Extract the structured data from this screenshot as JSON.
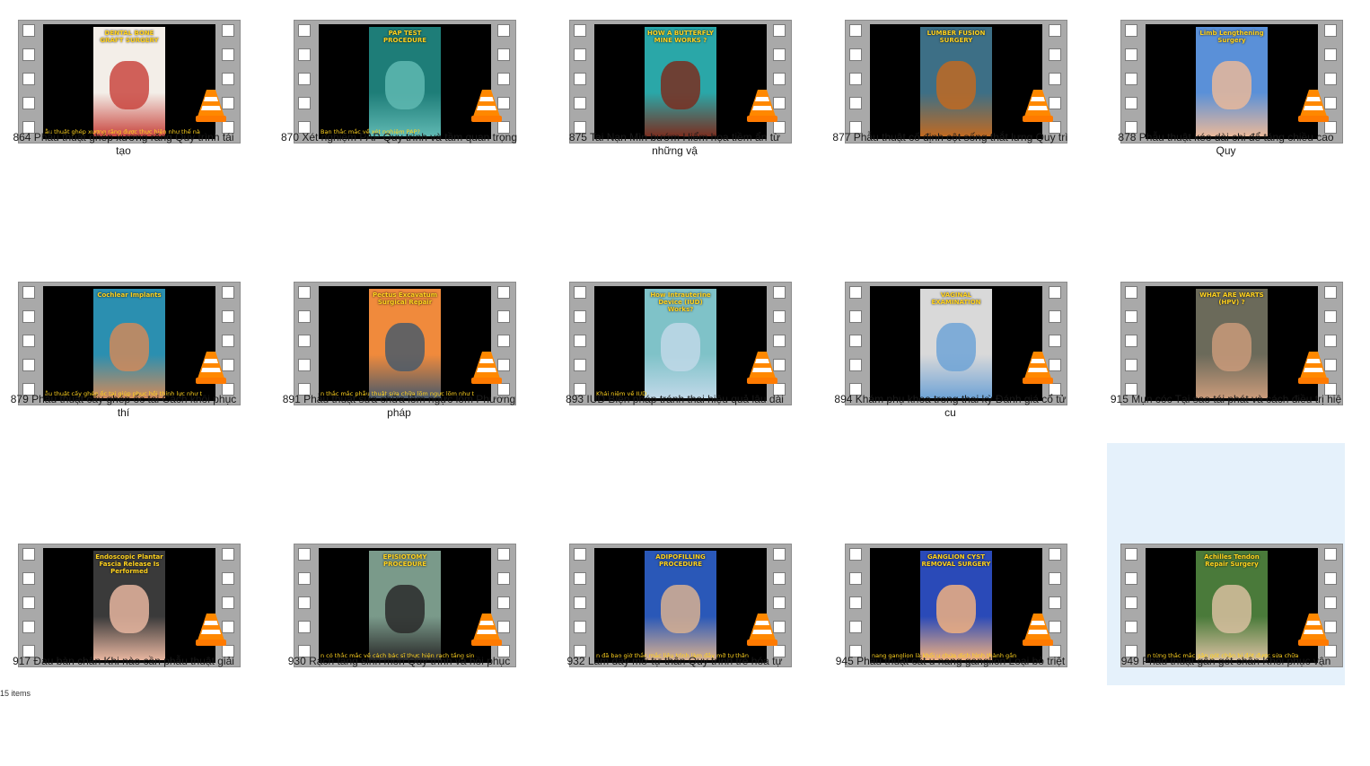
{
  "items": [
    {
      "label": "864 Phẫu thuật ghép xương răng Quy trình tái tạo",
      "poster_title": "DENTAL BONE GRAFT SURGERY",
      "subtitle": "ẫu thuật ghép xương răng được thực hiện như thế nà",
      "bg": "#f3eee8",
      "accent": "#c9463f"
    },
    {
      "label": "870 Xét nghiệm PAP Quy trình và tầm quan trọng",
      "poster_title": "PAP TEST PROCEDURE",
      "subtitle": "Bạn thắc mắc về xét nghiệm PAP?",
      "bg": "#1e7d78",
      "accent": "#5fb8b2"
    },
    {
      "label": "875 Tai Nạn Mìn bướm Hiểm họa tiềm ẩn từ những vậ",
      "poster_title": "HOW A BUTTERFLY MINE WORKS ?",
      "subtitle": "",
      "bg": "#2aa7a8",
      "accent": "#7a2e20"
    },
    {
      "label": "877 Phẫu thuật cố định cột sống thắt lưng Quy trì",
      "poster_title": "LUMBER FUSION SURGERY",
      "subtitle": "",
      "bg": "#3d6f86",
      "accent": "#c06a22"
    },
    {
      "label": "878 Phẫu thuật kéo dài chi để tăng chiều cao Quy",
      "poster_title": "Limb Lengthening Surgery",
      "subtitle": "",
      "bg": "#5a90d8",
      "accent": "#e9b89a"
    },
    {
      "label": "879 Phẫu thuật cấy ghép ốc tai Cách khôi phục thí",
      "poster_title": "Cochlear Implants",
      "subtitle": "ẫu thuật cấy ghép ốc tai giúp phục hồi thính lực như t",
      "bg": "#2b8fb0",
      "accent": "#d08a5a"
    },
    {
      "label": "891 Phẫu thuật sửa chữa lõm ngực lõm Phương pháp",
      "poster_title": "Pectus Excavatum Surgical Repair",
      "subtitle": "n thắc mắc phẫu thuật sửa chữa lõm ngực lõm như t",
      "bg": "#f08a3c",
      "accent": "#4a5a6a"
    },
    {
      "label": "893 IUD Biện pháp tránh thai hiệu quả lâu dài",
      "poster_title": "How Intrauterine Device (IUD) Works?",
      "subtitle": "Khái niệm về IUD",
      "bg": "#7fc2c8",
      "accent": "#c0d8e8"
    },
    {
      "label": "894 Khám phụ khoa trong thai kỳ Đánh giá cổ tử cu",
      "poster_title": "VAGINAL EXAMINATION",
      "subtitle": "",
      "bg": "#d9d9d9",
      "accent": "#6fa3d6"
    },
    {
      "label": "915 Mụn cóc Tại sao tái phát và cách điều trị hiệ",
      "poster_title": "WHAT ARE WARTS (HPV) ?",
      "subtitle": "",
      "bg": "#6b6a5a",
      "accent": "#c99a7a"
    },
    {
      "label": "917 Đau bàn chân Khi nào cần phẫu thuật giải",
      "poster_title": "Endoscopic Plantar Fascia Release Is Performed",
      "subtitle": "",
      "bg": "#3a3a3a",
      "accent": "#e8b6a0"
    },
    {
      "label": "930 Rạch tầng sinh môn Quy trình và hồi phục",
      "poster_title": "EPISIOTOMY PROCEDURE",
      "subtitle": "n có thắc mắc về cách bác sĩ thực hiện rạch tầng sin",
      "bg": "#7a9a8a",
      "accent": "#2a2a2a"
    },
    {
      "label": "932 Làm đầy mỡ tự thân Quy trình trẻ hóa tự",
      "poster_title": "ADIPOFILLING PROCEDURE",
      "subtitle": "n đã bao giờ thắc mắc liệu trình làm đầy mỡ tự thân",
      "bg": "#2a58b8",
      "accent": "#d8b090"
    },
    {
      "label": "945 Phẫu thuật cắt u nang ganglion Loại bỏ triệt",
      "poster_title": "GANGLION CYST REMOVAL SURGERY",
      "subtitle": "nang ganglion là khối u chứa dịch hình thành gần",
      "bg": "#2a4ab8",
      "accent": "#f0b080"
    },
    {
      "label": "949 Phẫu thuật gân gót chân Khôi phục vận",
      "poster_title": "Achilles Tendon Repair Surgery",
      "subtitle": "n từng thắc mắc gân gót chân bị đứt được sửa chữa",
      "bg": "#4a7a3a",
      "accent": "#d8c0a0"
    }
  ],
  "status": {
    "text": "15 items"
  }
}
